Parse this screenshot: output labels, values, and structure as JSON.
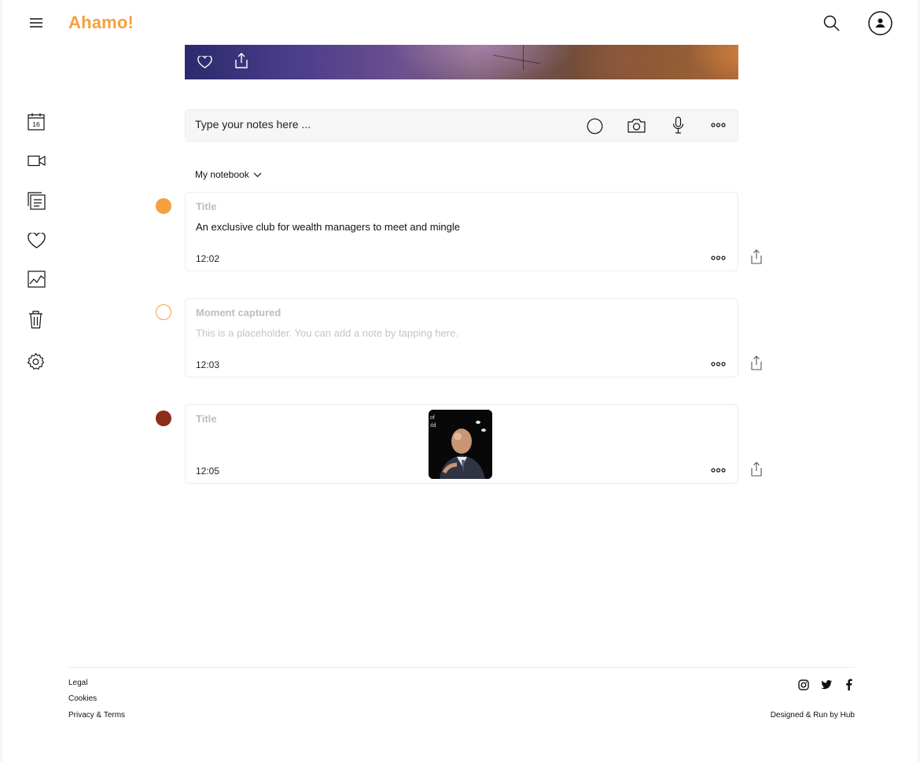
{
  "app": {
    "brand": "Ahamo!",
    "accent": "#f5a03c"
  },
  "header": {
    "menu_icon": "hamburger-icon",
    "search_icon": "search-icon",
    "account_icon": "user-avatar-icon"
  },
  "sidebar": {
    "items": [
      {
        "icon": "calendar-icon",
        "label": "16"
      },
      {
        "icon": "video-camera-icon"
      },
      {
        "icon": "notes-icon"
      },
      {
        "icon": "heart-icon"
      },
      {
        "icon": "chart-icon"
      },
      {
        "icon": "trash-icon"
      },
      {
        "icon": "settings-gear-icon"
      }
    ]
  },
  "hero": {
    "actions": [
      "heart-icon",
      "share-icon"
    ]
  },
  "composer": {
    "placeholder": "Type your notes here ...",
    "tools": [
      "circle-icon",
      "camera-icon",
      "microphone-icon",
      "more-icon"
    ]
  },
  "notebook": {
    "label": "My notebook"
  },
  "notes": [
    {
      "dot_color": "#f5a03c",
      "dot_style": "filled",
      "title": "Title",
      "body": "An exclusive club for wealth managers to meet and mingle",
      "time": "12:02"
    },
    {
      "dot_color": "#f5a03c",
      "dot_style": "outline",
      "title": "Moment captured",
      "body": "This is a placeholder. You can add a note by tapping here.",
      "time": "12:03"
    },
    {
      "dot_color": "#8b2e1a",
      "dot_style": "filled",
      "title": "Title",
      "body": "",
      "time": "12:05",
      "has_photo": true
    }
  ],
  "footer": {
    "links": [
      "Legal",
      "Cookies",
      "Privacy & Terms"
    ],
    "social": [
      "instagram-icon",
      "twitter-icon",
      "facebook-icon"
    ],
    "credit": "Designed & Run by Hub"
  }
}
